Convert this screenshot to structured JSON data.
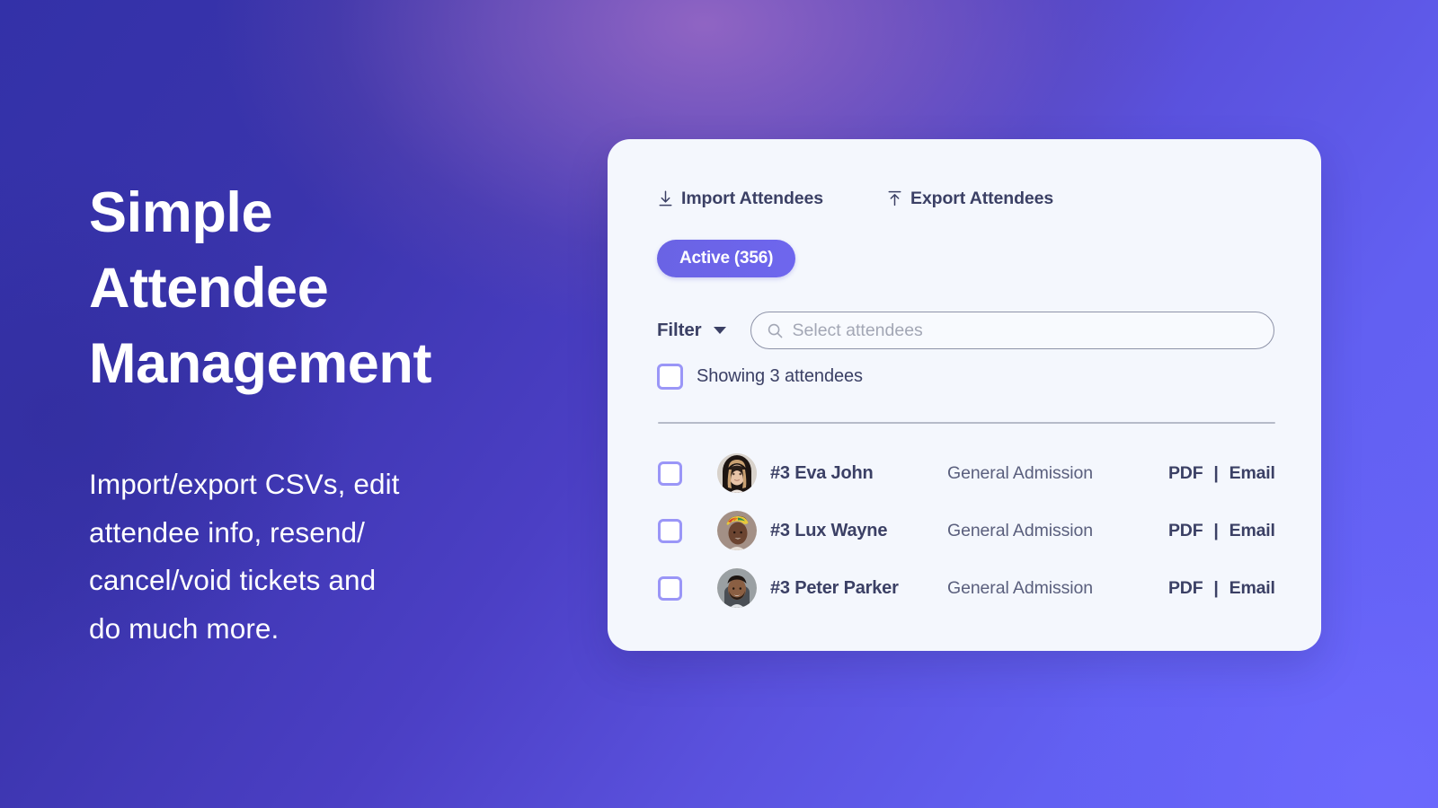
{
  "colors": {
    "bg_dark_indigo": "#3331A8",
    "bg_purple_glow": "#6A51B8",
    "bg_periwinkle": "#6561F5",
    "card_bg": "#F4F7FD",
    "accent_pill": "#6C63E8",
    "text_dark": "#3B4065",
    "checkbox_border": "#9A96F7",
    "divider": "#B6BBC9",
    "placeholder": "#A3A7B5"
  },
  "hero": {
    "headline": "Simple\nAttendee\nManagement",
    "subcopy": "Import/export CSVs, edit\nattendee info, resend/\ncancel/void tickets and\ndo much more."
  },
  "card": {
    "import_label": "Import Attendees",
    "export_label": "Export Attendees",
    "import_icon": "download-icon",
    "export_icon": "upload-icon",
    "active_tab": "Active (356)",
    "filter_label": "Filter",
    "filter_caret_icon": "chevron-down-icon",
    "search": {
      "icon": "search-icon",
      "placeholder": "Select attendees",
      "value": ""
    },
    "showing_text": "Showing 3 attendees",
    "select_all_checked": false,
    "attendees": [
      {
        "checked": false,
        "avatar": "woman-blonde-avatar",
        "name": "#3 Eva John",
        "ticket_type": "General Admission",
        "action_pdf": "PDF",
        "action_separator": "|",
        "action_email": "Email"
      },
      {
        "checked": false,
        "avatar": "woman-headwrap-avatar",
        "name": "#3 Lux Wayne",
        "ticket_type": "General Admission",
        "action_pdf": "PDF",
        "action_separator": "|",
        "action_email": "Email"
      },
      {
        "checked": false,
        "avatar": "man-beard-avatar",
        "name": "#3 Peter Parker",
        "ticket_type": "General Admission",
        "action_pdf": "PDF",
        "action_separator": "|",
        "action_email": "Email"
      }
    ]
  }
}
